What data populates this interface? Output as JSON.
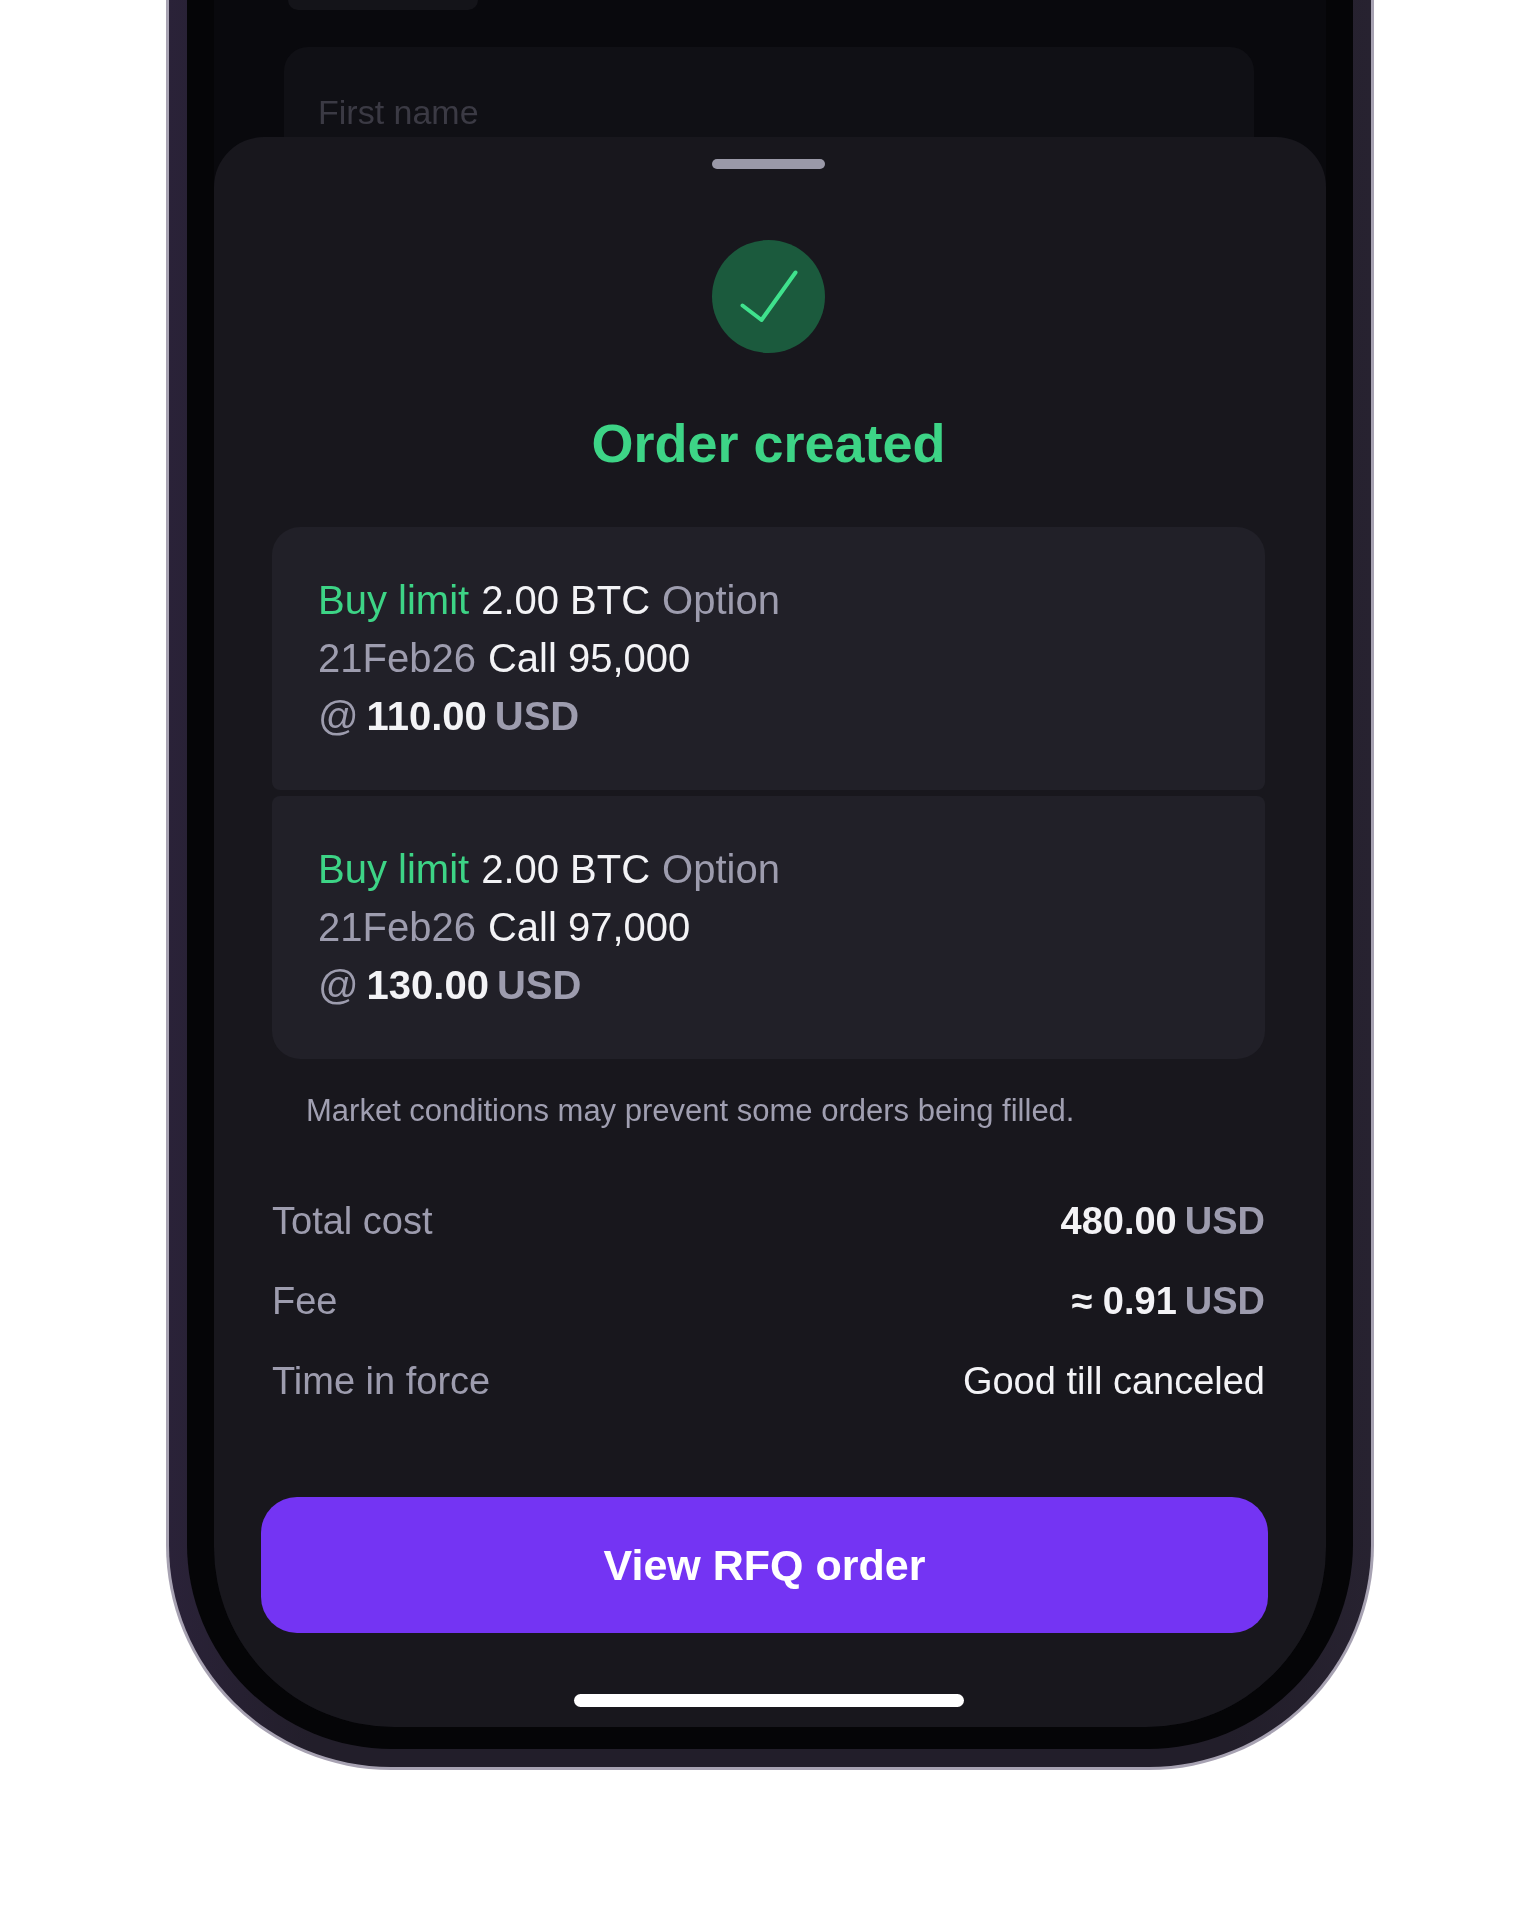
{
  "background_screen": {
    "field": {
      "placeholder": "First name"
    }
  },
  "sheet": {
    "title": "Order created",
    "orders": [
      {
        "side": "Buy limit",
        "quantity": "2.00 BTC",
        "instrument": "Option",
        "expiry": "21Feb26",
        "contract": "Call 95,000",
        "at": "@",
        "price": "110.00",
        "currency": "USD"
      },
      {
        "side": "Buy limit",
        "quantity": "2.00 BTC",
        "instrument": "Option",
        "expiry": "21Feb26",
        "contract": "Call 97,000",
        "at": "@",
        "price": "130.00",
        "currency": "USD"
      }
    ],
    "note": "Market conditions may prevent some orders being filled.",
    "summary": [
      {
        "kind": "amount",
        "label": "Total cost",
        "value": "480.00",
        "unit": "USD"
      },
      {
        "kind": "amount",
        "label": "Fee",
        "value": "≈ 0.91",
        "unit": "USD"
      },
      {
        "kind": "text",
        "label": "Time in force",
        "value": "Good till canceled"
      }
    ],
    "button": {
      "label": "View RFQ order"
    }
  }
}
